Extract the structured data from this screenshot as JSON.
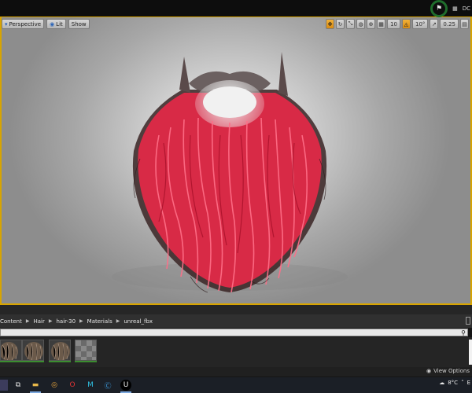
{
  "topbar": {
    "right_label": "DC"
  },
  "viewport": {
    "perspective_label": "Perspective",
    "lit_label": "Lit",
    "show_label": "Show",
    "grid_snap_value": "10",
    "rotation_snap_value": "10°",
    "scale_snap_value": "0.25"
  },
  "content_browser": {
    "breadcrumb": [
      "Content",
      "Hair",
      "hair-30",
      "Materials",
      "unreal_fbx"
    ],
    "view_options_label": "View Options"
  },
  "taskbar": {
    "temperature": "8°C",
    "tray_letter": "E"
  },
  "colors": {
    "accent_yellow": "#d8a400",
    "hair_red": "#e03150",
    "asset_green": "#3b8d2f"
  }
}
